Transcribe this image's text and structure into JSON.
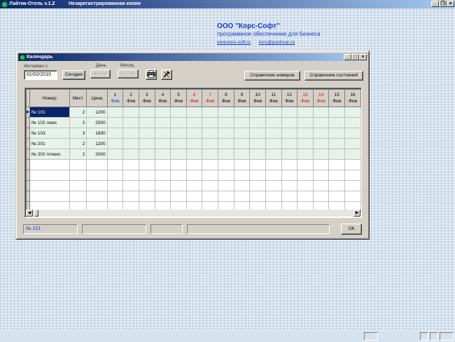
{
  "app": {
    "title": "Лайтик-Отель v.1.2",
    "registration": "Незарегистрированная копия",
    "controls": {
      "minimize": "_",
      "restore": "❐",
      "close": "×"
    }
  },
  "company": {
    "name": "ООО \"Корс-Софт\"",
    "tagline": "программное обеспечение для бизнеса",
    "website": "www.kors-soft.ru",
    "email": "kors@postman.ru"
  },
  "dialog": {
    "title": "Календарь",
    "controls": {
      "minimize": "_",
      "maximize": "□",
      "close": "×"
    },
    "interval_label": "Интервал с",
    "interval_value": "01/02/2010",
    "today_button": "Сегодня",
    "day_label": "День",
    "day_buttons": [
      "<--",
      "-->"
    ],
    "month_label": "Месяц",
    "month_buttons": [
      "<--",
      "-->"
    ],
    "print_icon": "printer-icon",
    "tools_icon": "tools-icon",
    "rooms_ref_button": "Справочник номеров",
    "states_ref_button": "Справочник состояний",
    "ok_button": "ОК"
  },
  "grid": {
    "columns": {
      "number": "Номер",
      "places": "Мест",
      "price": "Цена"
    },
    "days": [
      {
        "d": "1",
        "m": "Фев",
        "kind": "cur"
      },
      {
        "d": "2",
        "m": "Фев",
        "kind": ""
      },
      {
        "d": "3",
        "m": "Фев",
        "kind": ""
      },
      {
        "d": "4",
        "m": "Фев",
        "kind": ""
      },
      {
        "d": "5",
        "m": "Фев",
        "kind": ""
      },
      {
        "d": "6",
        "m": "Фев",
        "kind": "we"
      },
      {
        "d": "7",
        "m": "Фев",
        "kind": "we"
      },
      {
        "d": "8",
        "m": "Фев",
        "kind": ""
      },
      {
        "d": "9",
        "m": "Фев",
        "kind": ""
      },
      {
        "d": "10",
        "m": "Фев",
        "kind": ""
      },
      {
        "d": "11",
        "m": "Фев",
        "kind": ""
      },
      {
        "d": "12",
        "m": "Фев",
        "kind": ""
      },
      {
        "d": "13",
        "m": "Фев",
        "kind": "we"
      },
      {
        "d": "14",
        "m": "Фев",
        "kind": "we"
      },
      {
        "d": "15",
        "m": "Фев",
        "kind": ""
      },
      {
        "d": "16",
        "m": "Фев",
        "kind": ""
      }
    ],
    "rows": [
      {
        "number": "№ 101",
        "places": "2",
        "price": "1200"
      },
      {
        "number": "№ 102 люкс",
        "places": "2",
        "price": "2500"
      },
      {
        "number": "№ 103",
        "places": "3",
        "price": "1800"
      },
      {
        "number": "№ 201",
        "places": "2",
        "price": "1200"
      },
      {
        "number": "№ 202 п/люкс",
        "places": "2",
        "price": "2000"
      }
    ],
    "selected_row": 0,
    "empty_rows": 5
  },
  "status": {
    "current_room": "№ 101"
  }
}
